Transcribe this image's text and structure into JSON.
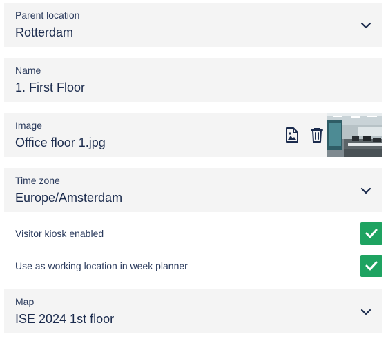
{
  "parent_location": {
    "label": "Parent location",
    "value": "Rotterdam"
  },
  "name": {
    "label": "Name",
    "value": "1. First Floor"
  },
  "image": {
    "label": "Image",
    "value": "Office floor 1.jpg"
  },
  "time_zone": {
    "label": "Time zone",
    "value": "Europe/Amsterdam"
  },
  "toggles": [
    {
      "label": "Visitor kiosk enabled",
      "checked": true
    },
    {
      "label": "Use as working location in week planner",
      "checked": true
    }
  ],
  "map": {
    "label": "Map",
    "value": "ISE 2024 1st floor"
  },
  "colors": {
    "field_bg": "#f4f4f4",
    "text": "#1b2b4d",
    "check": "#1ea361"
  }
}
